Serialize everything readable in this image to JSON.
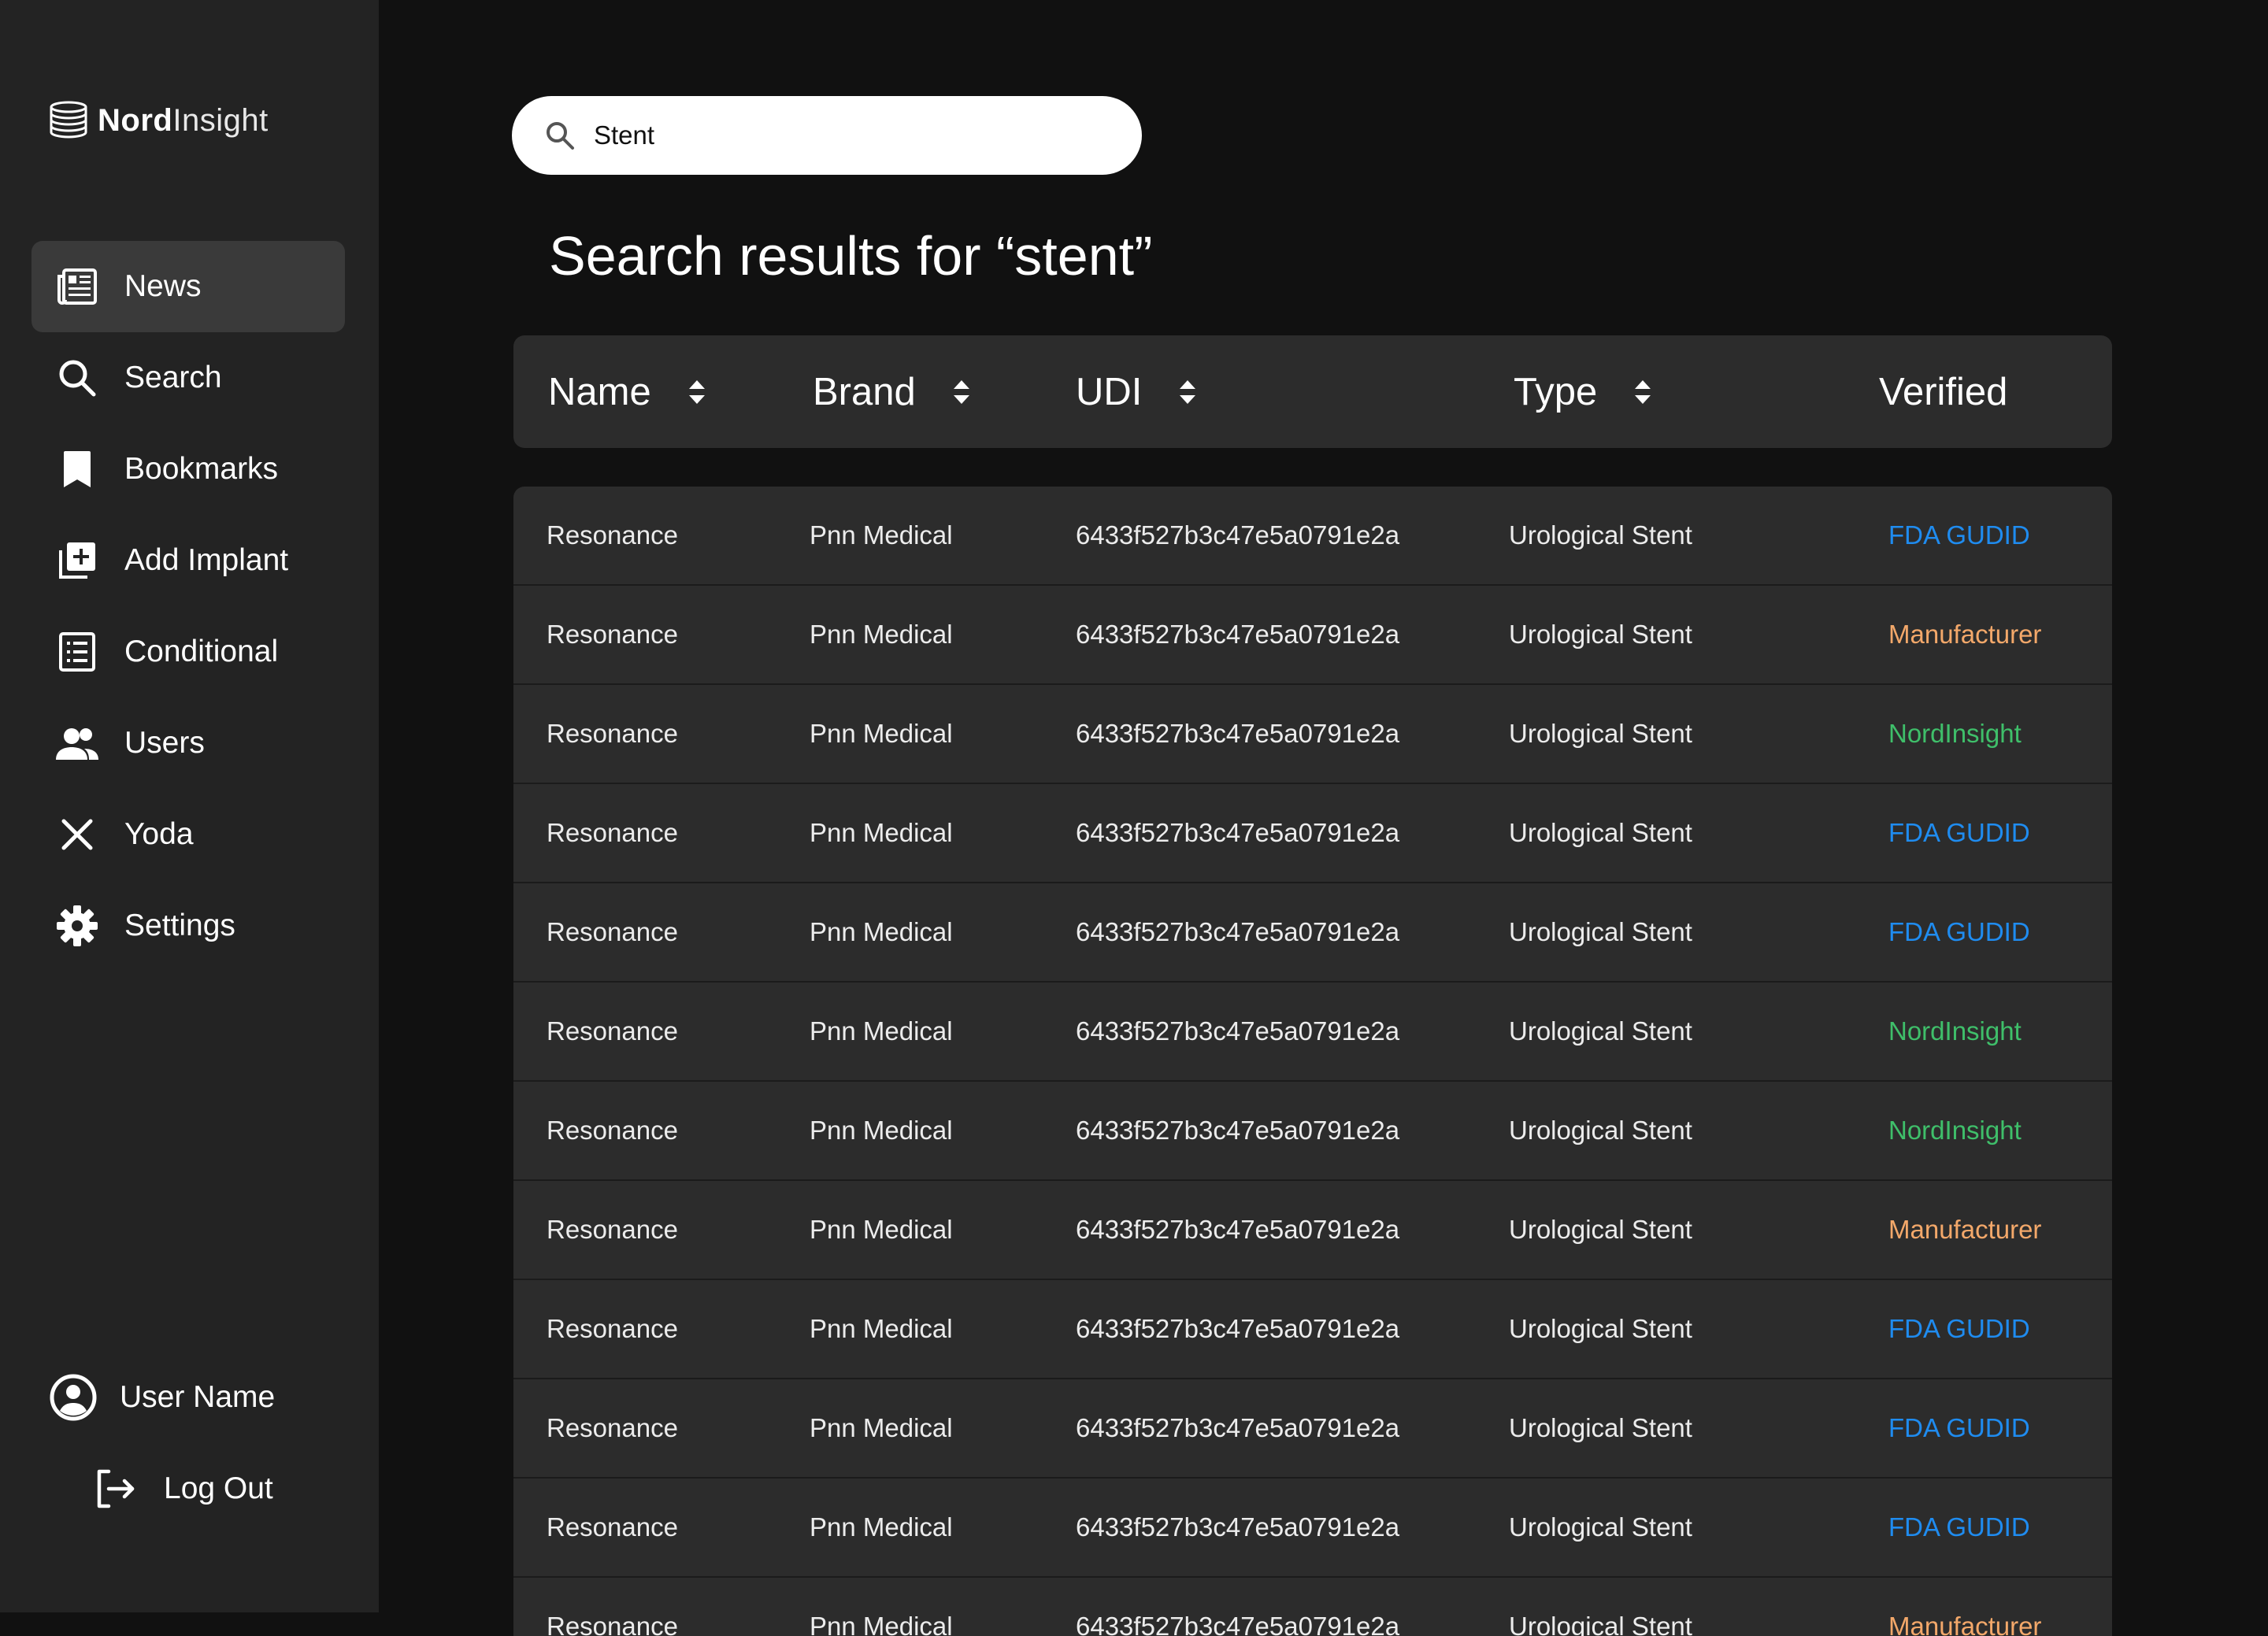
{
  "app": {
    "logo_bold": "Nord",
    "logo_light": "Insight"
  },
  "sidebar": {
    "items": [
      {
        "label": "News",
        "icon": "newspaper-icon",
        "active": true
      },
      {
        "label": "Search",
        "icon": "search-icon",
        "active": false
      },
      {
        "label": "Bookmarks",
        "icon": "bookmark-icon",
        "active": false
      },
      {
        "label": "Add Implant",
        "icon": "add-box-icon",
        "active": false
      },
      {
        "label": "Conditional",
        "icon": "list-icon",
        "active": false
      },
      {
        "label": "Users",
        "icon": "users-icon",
        "active": false
      },
      {
        "label": "Yoda",
        "icon": "close-x-icon",
        "active": false
      },
      {
        "label": "Settings",
        "icon": "gear-icon",
        "active": false
      }
    ],
    "user_name": "User Name",
    "logout_label": "Log Out"
  },
  "search": {
    "value": "Stent",
    "placeholder": ""
  },
  "results_title": "Search results for “stent”",
  "table": {
    "columns": [
      "Name",
      "Brand",
      "UDI",
      "Type",
      "Verified"
    ],
    "rows": [
      {
        "name": "Resonance",
        "brand": "Pnn Medical",
        "udi": "6433f527b3c47e5a0791e2a",
        "type": "Urological Stent",
        "verified": "FDA GUDID"
      },
      {
        "name": "Resonance",
        "brand": "Pnn Medical",
        "udi": "6433f527b3c47e5a0791e2a",
        "type": "Urological Stent",
        "verified": "Manufacturer"
      },
      {
        "name": "Resonance",
        "brand": "Pnn Medical",
        "udi": "6433f527b3c47e5a0791e2a",
        "type": "Urological Stent",
        "verified": "NordInsight"
      },
      {
        "name": "Resonance",
        "brand": "Pnn Medical",
        "udi": "6433f527b3c47e5a0791e2a",
        "type": "Urological Stent",
        "verified": "FDA GUDID"
      },
      {
        "name": "Resonance",
        "brand": "Pnn Medical",
        "udi": "6433f527b3c47e5a0791e2a",
        "type": "Urological Stent",
        "verified": "FDA GUDID"
      },
      {
        "name": "Resonance",
        "brand": "Pnn Medical",
        "udi": "6433f527b3c47e5a0791e2a",
        "type": "Urological Stent",
        "verified": "NordInsight"
      },
      {
        "name": "Resonance",
        "brand": "Pnn Medical",
        "udi": "6433f527b3c47e5a0791e2a",
        "type": "Urological Stent",
        "verified": "NordInsight"
      },
      {
        "name": "Resonance",
        "brand": "Pnn Medical",
        "udi": "6433f527b3c47e5a0791e2a",
        "type": "Urological Stent",
        "verified": "Manufacturer"
      },
      {
        "name": "Resonance",
        "brand": "Pnn Medical",
        "udi": "6433f527b3c47e5a0791e2a",
        "type": "Urological Stent",
        "verified": "FDA GUDID"
      },
      {
        "name": "Resonance",
        "brand": "Pnn Medical",
        "udi": "6433f527b3c47e5a0791e2a",
        "type": "Urological Stent",
        "verified": "FDA GUDID"
      },
      {
        "name": "Resonance",
        "brand": "Pnn Medical",
        "udi": "6433f527b3c47e5a0791e2a",
        "type": "Urological Stent",
        "verified": "FDA GUDID"
      },
      {
        "name": "Resonance",
        "brand": "Pnn Medical",
        "udi": "6433f527b3c47e5a0791e2a",
        "type": "Urological Stent",
        "verified": "Manufacturer"
      }
    ]
  },
  "colors": {
    "fda": "#1f8cf0",
    "manufacturer": "#f3a86a",
    "nordinsight": "#3fbf6a",
    "sidebar_bg": "#232323",
    "page_bg": "#111111",
    "panel_bg": "#2c2c2c"
  }
}
